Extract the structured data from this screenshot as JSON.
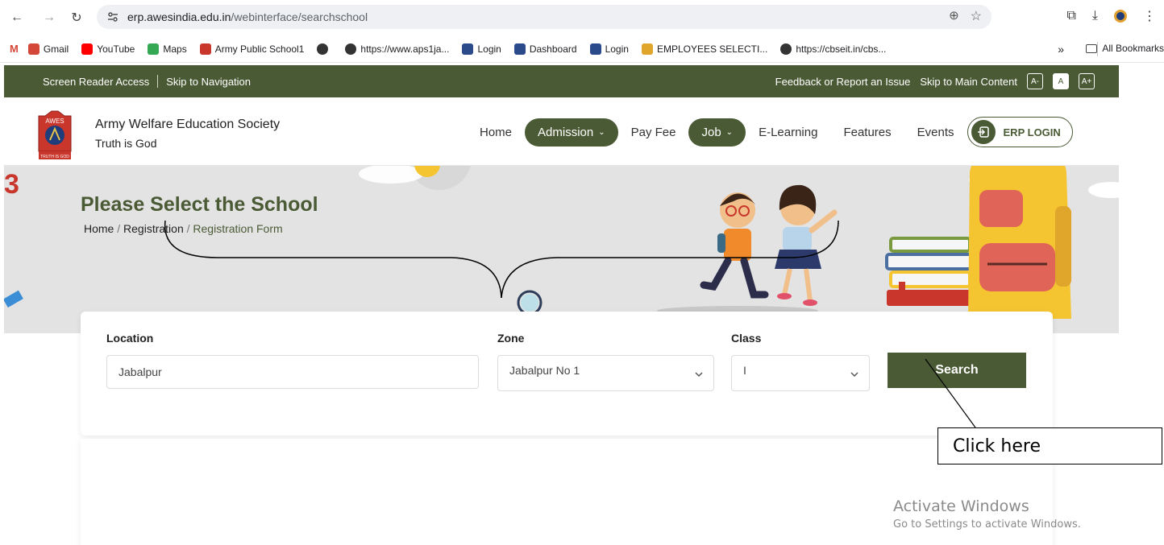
{
  "browser": {
    "url_secure_part": "erp.awesindia.edu.in",
    "url_path": "/webinterface/searchschool"
  },
  "bookmarks": [
    {
      "label": "Gmail",
      "icon": "gmail-icon"
    },
    {
      "label": "YouTube",
      "icon": "youtube-icon"
    },
    {
      "label": "Maps",
      "icon": "maps-icon"
    },
    {
      "label": "Army Public School1",
      "icon": "school-icon"
    },
    {
      "label": "",
      "icon": "globe-icon"
    },
    {
      "label": "https://www.aps1ja...",
      "icon": "globe-icon"
    },
    {
      "label": "Login",
      "icon": "portal-icon"
    },
    {
      "label": "Dashboard",
      "icon": "portal-icon"
    },
    {
      "label": "Login",
      "icon": "portal-icon"
    },
    {
      "label": "EMPLOYEES SELECTI...",
      "icon": "employee-icon"
    },
    {
      "label": "https://cbseit.in/cbs...",
      "icon": "globe-icon"
    }
  ],
  "bookmarks_more": "»",
  "bookmarks_all": "All Bookmarks",
  "topstrip": {
    "screen_reader": "Screen Reader Access",
    "skip_nav": "Skip to Navigation",
    "feedback": "Feedback or Report an Issue",
    "skip_main": "Skip to Main Content",
    "font_small": "A-",
    "font_normal": "A",
    "font_large": "A+"
  },
  "header": {
    "logo_top": "AWES",
    "logo_bottom": "TRUTH IS GOD",
    "org_name": "Army Welfare Education Society",
    "tagline": "Truth is God",
    "nav": {
      "home": "Home",
      "admission": "Admission",
      "pay_fee": "Pay Fee",
      "job": "Job",
      "elearning": "E-Learning",
      "features": "Features",
      "events": "Events",
      "erp_login": "ERP LOGIN"
    }
  },
  "banner": {
    "title": "Please Select the School",
    "crumb_home": "Home",
    "crumb_registration": "Registration",
    "crumb_current": "Registration Form",
    "crumb_sep": "/",
    "corner_digit": "3"
  },
  "form": {
    "location_label": "Location",
    "location_value": "Jabalpur",
    "zone_label": "Zone",
    "zone_value": "Jabalpur No 1",
    "class_label": "Class",
    "class_value": "I",
    "search_label": "Search"
  },
  "annotation": {
    "callout_text": "Click here"
  },
  "watermark": {
    "line1": "Activate Windows",
    "line2": "Go to Settings to activate Windows."
  },
  "colors": {
    "brand_green": "#4a5a35",
    "banner_bg": "#e3e3e3"
  }
}
